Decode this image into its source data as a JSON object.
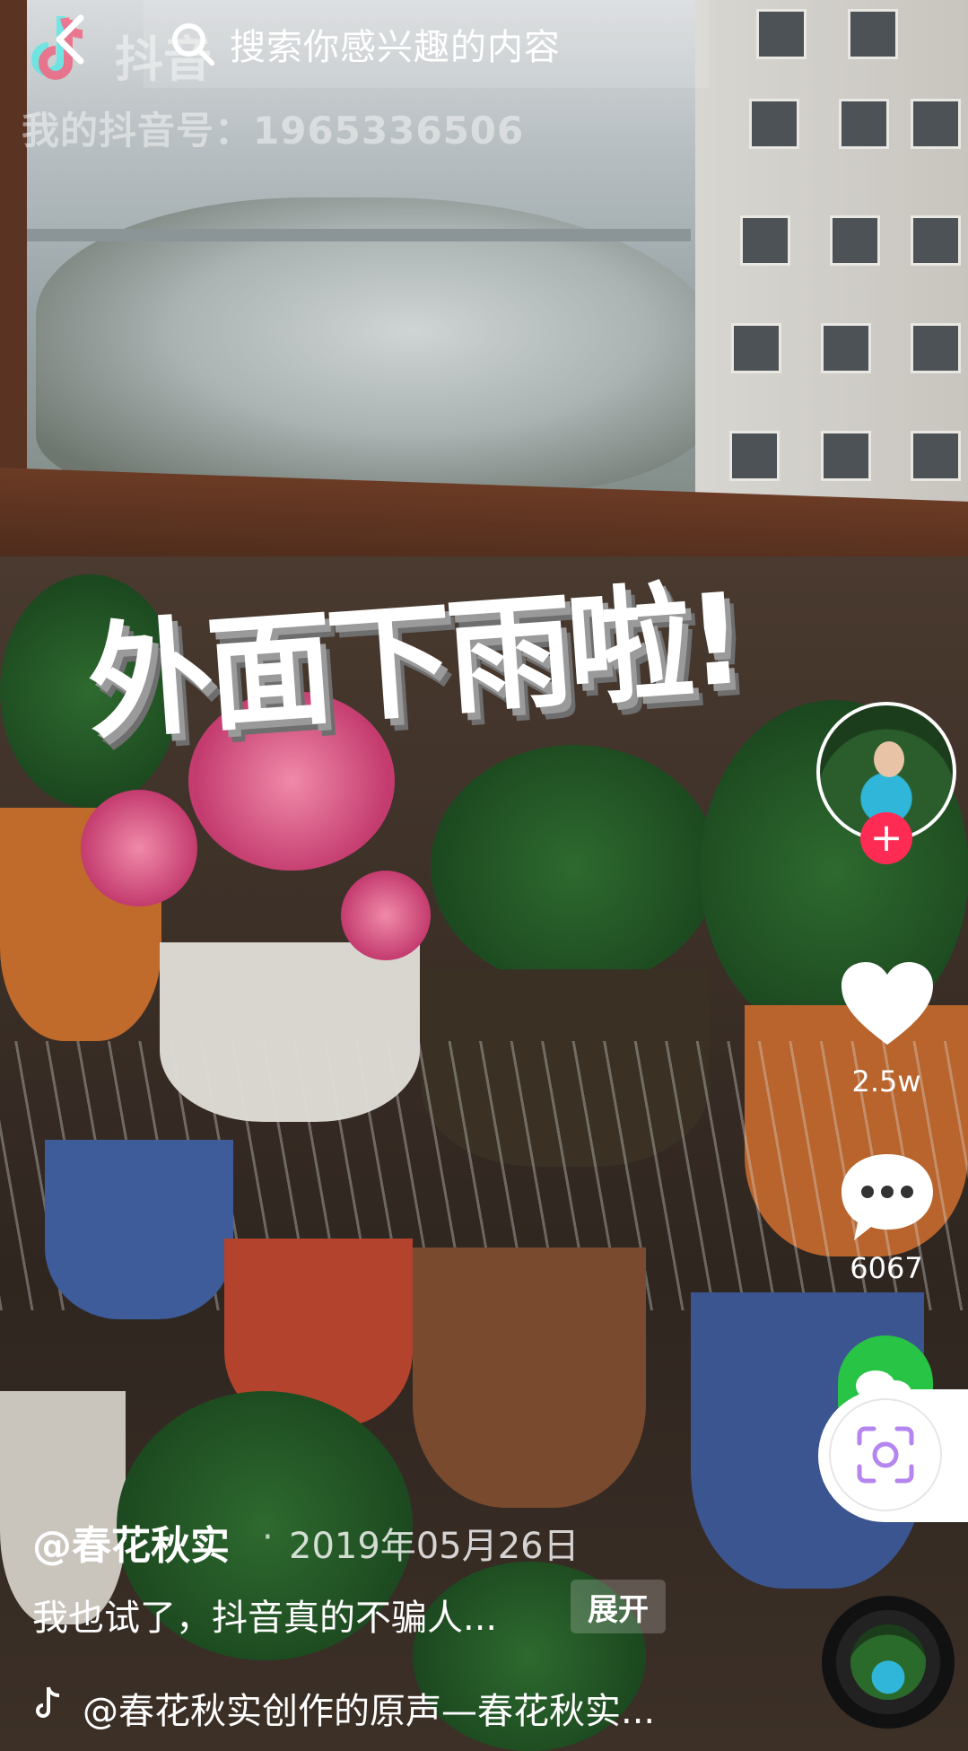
{
  "header": {
    "logo_text": "抖音",
    "search_placeholder": "搜索你感兴趣的内容",
    "douyin_id": "我的抖音号：1965336506"
  },
  "video": {
    "overlay_text": "外面下雨啦!"
  },
  "sidebar": {
    "like_count": "2.5w",
    "comment_count": "6067"
  },
  "post": {
    "author": "@春花秋实",
    "separator": "·",
    "date": "2019年05月26日",
    "caption": "我也试了，抖音真的不骗人...",
    "expand_label": "展开",
    "music": "@春花秋实创作的原声—春花秋实..."
  },
  "colors": {
    "follow": "#fe2c55",
    "share": "#28c445",
    "scan": "#b586f0"
  }
}
